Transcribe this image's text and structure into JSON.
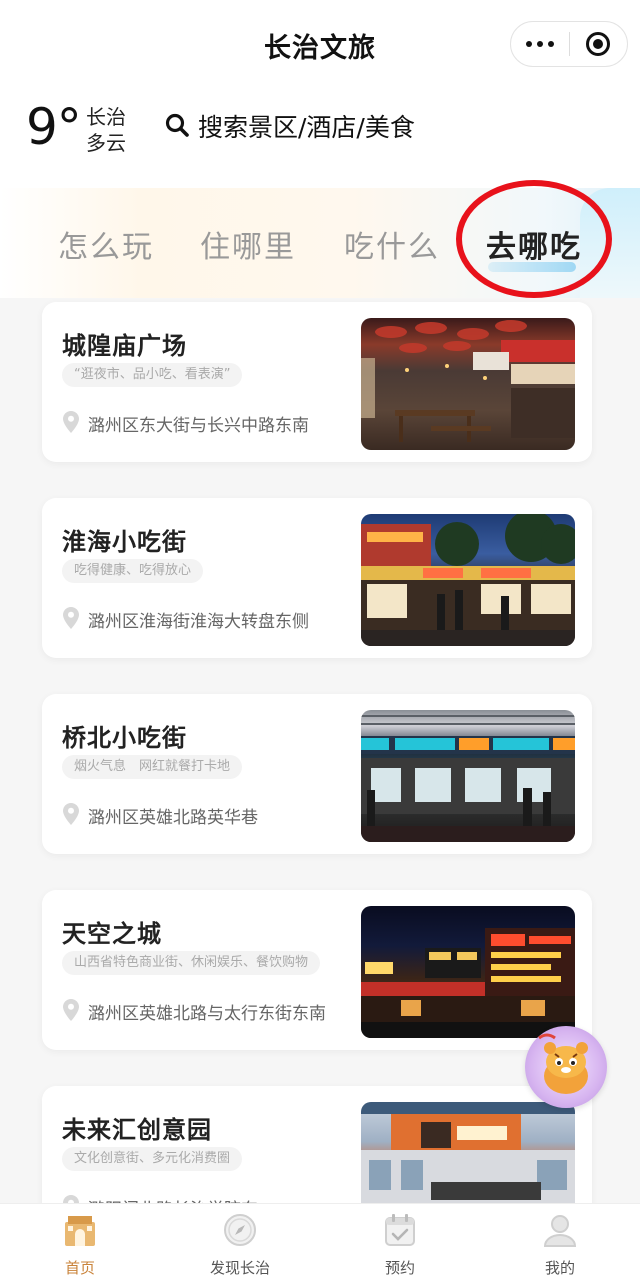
{
  "header": {
    "title": "长治文旅"
  },
  "weather": {
    "temperature": "9°",
    "city": "长治",
    "condition": "多云"
  },
  "search": {
    "placeholder": "搜索景区/酒店/美食"
  },
  "tabs": [
    {
      "label": "怎么玩",
      "active": false
    },
    {
      "label": "住哪里",
      "active": false
    },
    {
      "label": "吃什么",
      "active": false
    },
    {
      "label": "去哪吃",
      "active": true
    }
  ],
  "places": [
    {
      "name": "城隍庙广场",
      "tag": "“逛夜市、品小吃、看表演”",
      "address": "潞州区东大街与长兴中路东南",
      "photo": "night-food-market-photo"
    },
    {
      "name": "淮海小吃街",
      "tag": "吃得健康、吃得放心",
      "address": "潞州区淮海街淮海大转盘东侧",
      "photo": "snack-street-photo"
    },
    {
      "name": "桥北小吃街",
      "tag": "烟火气息　网红就餐打卡地",
      "address": "潞州区英雄北路英华巷",
      "photo": "snack-street-night-photo"
    },
    {
      "name": "天空之城",
      "tag": "山西省特色商业街、休闲娱乐、餐饮购物",
      "address": "潞州区英雄北路与太行东街东南",
      "photo": "commercial-street-photo"
    },
    {
      "name": "未来汇创意园",
      "tag": "文化创意街、多元化消费圈",
      "address": "潞阳门北路长治学院东",
      "photo": "creative-park-photo"
    }
  ],
  "nav": [
    {
      "label": "首页",
      "icon": "home-gate-icon",
      "active": true
    },
    {
      "label": "发现长治",
      "icon": "compass-icon",
      "active": false
    },
    {
      "label": "预约",
      "icon": "calendar-check-icon",
      "active": false
    },
    {
      "label": "我的",
      "icon": "user-icon",
      "active": false
    }
  ],
  "colors": {
    "accent": "#c9833a",
    "annotation_red": "#e8121b",
    "tab_active": "#222222",
    "tab_inactive": "#999999"
  }
}
